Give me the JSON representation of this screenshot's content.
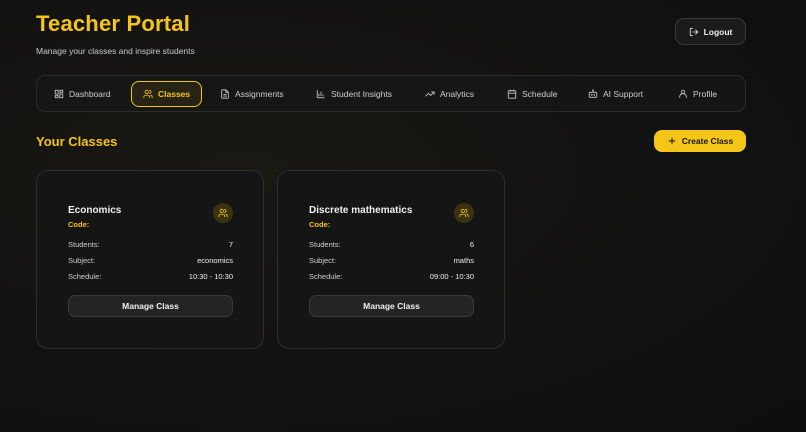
{
  "header": {
    "title": "Teacher Portal",
    "subtitle": "Manage your classes and inspire students",
    "logout_label": "Logout"
  },
  "nav": {
    "tabs": [
      {
        "label": "Dashboard",
        "icon": "dashboard-icon",
        "active": false
      },
      {
        "label": "Classes",
        "icon": "users-icon",
        "active": true
      },
      {
        "label": "Assignments",
        "icon": "document-icon",
        "active": false
      },
      {
        "label": "Student Insights",
        "icon": "bar-chart-icon",
        "active": false
      },
      {
        "label": "Analytics",
        "icon": "trending-up-icon",
        "active": false
      },
      {
        "label": "Schedule",
        "icon": "calendar-icon",
        "active": false
      },
      {
        "label": "AI Support",
        "icon": "robot-icon",
        "active": false
      },
      {
        "label": "Profile",
        "icon": "user-icon",
        "active": false
      }
    ]
  },
  "main": {
    "section_title": "Your Classes",
    "create_label": "Create Class",
    "classes": [
      {
        "name": "Economics",
        "code_label": "Code:",
        "students_label": "Students:",
        "students": "7",
        "subject_label": "Subject:",
        "subject": "economics",
        "schedule_label": "Schedule:",
        "schedule": "10:30 - 10:30",
        "manage_label": "Manage Class"
      },
      {
        "name": "Discrete mathematics",
        "code_label": "Code:",
        "students_label": "Students:",
        "students": "6",
        "subject_label": "Subject:",
        "subject": "maths",
        "schedule_label": "Schedule:",
        "schedule": "09:00 - 10:30",
        "manage_label": "Manage Class"
      }
    ]
  },
  "colors": {
    "accent": "#f5c518",
    "background": "#121212",
    "card": "#151515"
  }
}
